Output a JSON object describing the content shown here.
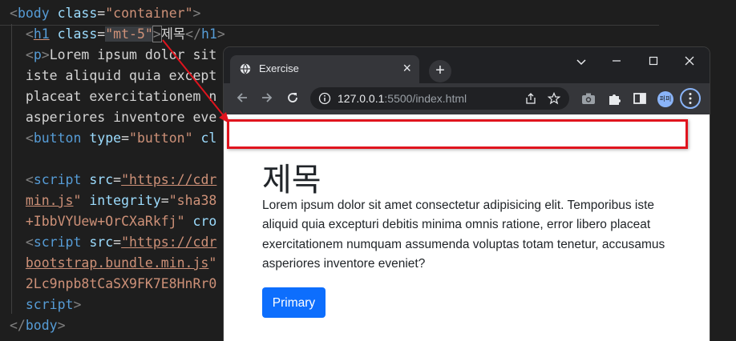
{
  "editor": {
    "lines": [
      {
        "parts": [
          {
            "c": "p",
            "v": "<"
          },
          {
            "c": "t",
            "v": "body"
          },
          {
            "c": "txt",
            "v": " "
          },
          {
            "c": "a",
            "v": "class"
          },
          {
            "c": "txt",
            "v": "="
          },
          {
            "c": "s",
            "v": "\"container\""
          },
          {
            "c": "p",
            "v": ">"
          }
        ]
      },
      {
        "parts": [
          {
            "c": "txt",
            "v": "  "
          },
          {
            "c": "p",
            "v": "<"
          },
          {
            "c": "t u",
            "v": "h1"
          },
          {
            "c": "txt",
            "v": " "
          },
          {
            "c": "a",
            "v": "class"
          },
          {
            "c": "txt",
            "v": "="
          },
          {
            "c": "s hl",
            "v": "\"mt-5\""
          },
          {
            "c": "p box",
            "v": ">"
          },
          {
            "c": "txt",
            "v": "제목"
          },
          {
            "c": "p",
            "v": "</"
          },
          {
            "c": "t",
            "v": "h1"
          },
          {
            "c": "p",
            "v": ">"
          }
        ]
      },
      {
        "parts": [
          {
            "c": "txt",
            "v": "  "
          },
          {
            "c": "p",
            "v": "<"
          },
          {
            "c": "t",
            "v": "p"
          },
          {
            "c": "p",
            "v": ">"
          },
          {
            "c": "txt",
            "v": "Lorem ipsum dolor sit"
          }
        ]
      },
      {
        "parts": [
          {
            "c": "txt",
            "v": "  iste aliquid quia except"
          }
        ]
      },
      {
        "parts": [
          {
            "c": "txt",
            "v": "  placeat exercitationem n"
          }
        ]
      },
      {
        "parts": [
          {
            "c": "txt",
            "v": "  asperiores inventore eve"
          }
        ]
      },
      {
        "parts": [
          {
            "c": "txt",
            "v": "  "
          },
          {
            "c": "p",
            "v": "<"
          },
          {
            "c": "t",
            "v": "button"
          },
          {
            "c": "txt",
            "v": " "
          },
          {
            "c": "a",
            "v": "type"
          },
          {
            "c": "txt",
            "v": "="
          },
          {
            "c": "s",
            "v": "\"button\""
          },
          {
            "c": "txt",
            "v": " "
          },
          {
            "c": "a",
            "v": "cl"
          }
        ]
      },
      {
        "parts": [
          {
            "c": "txt",
            "v": ""
          }
        ]
      },
      {
        "parts": [
          {
            "c": "txt",
            "v": "  "
          },
          {
            "c": "p",
            "v": "<"
          },
          {
            "c": "t",
            "v": "script"
          },
          {
            "c": "txt",
            "v": " "
          },
          {
            "c": "a",
            "v": "src"
          },
          {
            "c": "txt",
            "v": "="
          },
          {
            "c": "s u",
            "v": "\"https://cdr"
          }
        ]
      },
      {
        "parts": [
          {
            "c": "txt",
            "v": "  "
          },
          {
            "c": "s u",
            "v": "min.js"
          },
          {
            "c": "s",
            "v": "\""
          },
          {
            "c": "txt",
            "v": " "
          },
          {
            "c": "a",
            "v": "integrity"
          },
          {
            "c": "txt",
            "v": "="
          },
          {
            "c": "s",
            "v": "\"sha38"
          }
        ]
      },
      {
        "parts": [
          {
            "c": "txt",
            "v": "  "
          },
          {
            "c": "s",
            "v": "+IbbVYUew+OrCXaRkfj\""
          },
          {
            "c": "txt",
            "v": " "
          },
          {
            "c": "a",
            "v": "cro"
          }
        ]
      },
      {
        "parts": [
          {
            "c": "txt",
            "v": "  "
          },
          {
            "c": "p",
            "v": "<"
          },
          {
            "c": "t",
            "v": "script"
          },
          {
            "c": "txt",
            "v": " "
          },
          {
            "c": "a",
            "v": "src"
          },
          {
            "c": "txt",
            "v": "="
          },
          {
            "c": "s u",
            "v": "\"https://cdr"
          }
        ]
      },
      {
        "parts": [
          {
            "c": "txt",
            "v": "  "
          },
          {
            "c": "s u",
            "v": "bootstrap.bundle.min.js"
          },
          {
            "c": "s",
            "v": "\""
          }
        ]
      },
      {
        "parts": [
          {
            "c": "txt",
            "v": "  "
          },
          {
            "c": "s",
            "v": "2Lc9npb8tCaSX9FK7E8HnRr0"
          }
        ]
      },
      {
        "parts": [
          {
            "c": "txt",
            "v": "  "
          },
          {
            "c": "t",
            "v": "script"
          },
          {
            "c": "p",
            "v": ">"
          }
        ]
      },
      {
        "parts": [
          {
            "c": "p",
            "v": "</"
          },
          {
            "c": "t",
            "v": "body"
          },
          {
            "c": "p",
            "v": ">"
          }
        ]
      }
    ]
  },
  "browser": {
    "tab_title": "Exercise",
    "tab_close": "×",
    "new_tab": "+",
    "url_host": "127.0.0.1",
    "url_rest": ":5500/index.html",
    "profile_text": "퍼퍼",
    "heading": "제목",
    "paragraph": "Lorem ipsum dolor sit amet consectetur adipisicing elit. Temporibus iste aliquid quia excepturi debitis minima omnis ratione, error libero placeat exercitationem numquam assumenda voluptas totam tenetur, accusamus asperiores inventore eveniet?",
    "button_label": "Primary",
    "colors": {
      "primary_button": "#0d6efd",
      "annotation_red": "#e0141e",
      "editor_bg": "#1e1e1e"
    },
    "icons": [
      "globe-icon",
      "back-arrow-icon",
      "forward-arrow-icon",
      "reload-icon",
      "info-icon",
      "share-icon",
      "bookmark-star-icon",
      "camera-icon",
      "extensions-puzzle-icon",
      "sidebar-icon",
      "kebab-menu-icon",
      "minimize-icon",
      "maximize-icon",
      "close-window-icon",
      "tab-search-chevron-icon"
    ]
  }
}
